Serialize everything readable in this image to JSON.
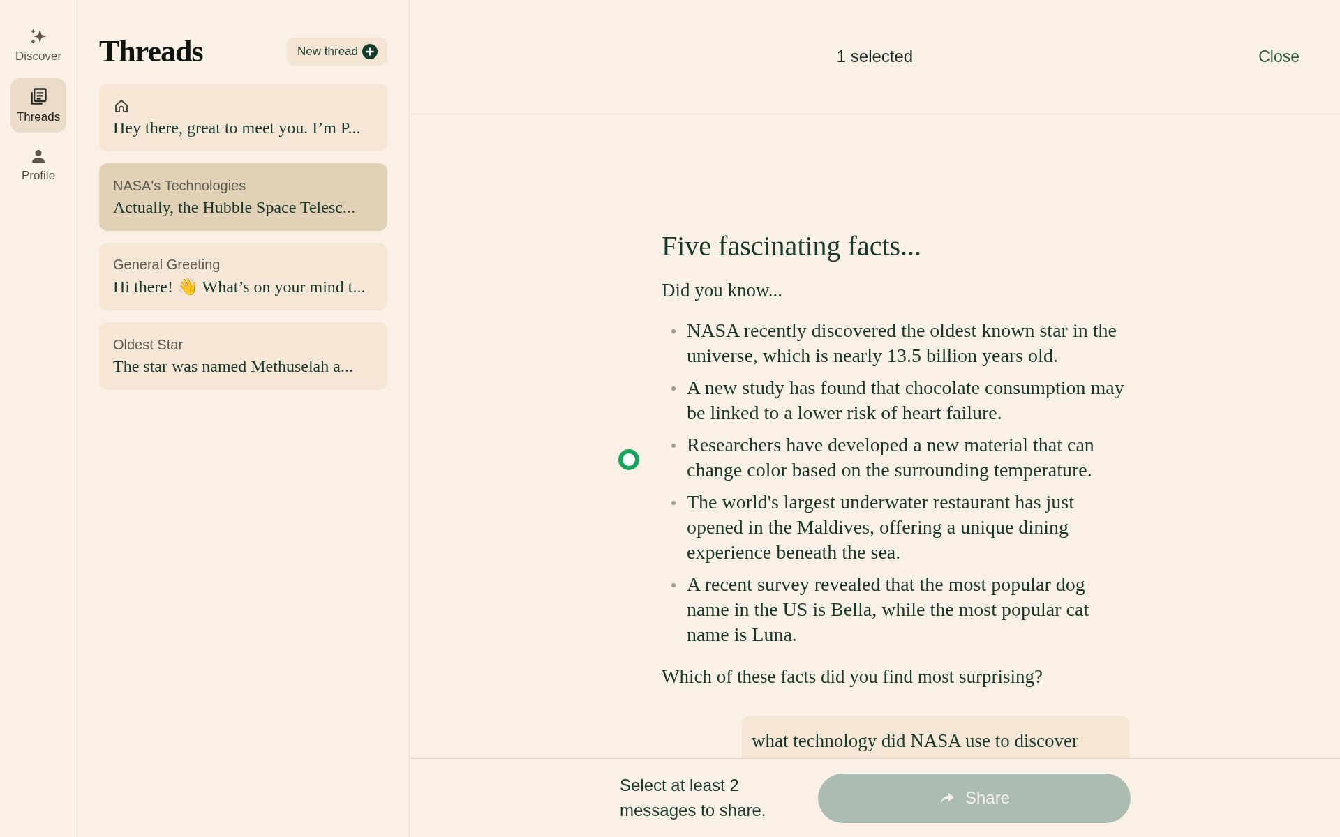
{
  "rail": [
    {
      "label": "Discover",
      "selected": false
    },
    {
      "label": "Threads",
      "selected": true
    },
    {
      "label": "Profile",
      "selected": false
    }
  ],
  "threads_panel": {
    "title": "Threads",
    "new_button": "New thread",
    "items": [
      {
        "kind": "home",
        "preview": "Hey there, great to meet you. I’m P...",
        "selected": false
      },
      {
        "kind": "titled",
        "title": "NASA's Technologies",
        "preview": "Actually, the Hubble Space Telesc...",
        "selected": true
      },
      {
        "kind": "titled",
        "title": "General Greeting",
        "preview": "Hi there! 👋 What’s on your mind t...",
        "selected": false
      },
      {
        "kind": "titled",
        "title": "Oldest Star",
        "preview": "The star was named Methuselah a...",
        "selected": false
      }
    ]
  },
  "header": {
    "status": "1 selected",
    "close": "Close"
  },
  "messages": [
    {
      "kind": "assistant",
      "selected": true,
      "heading": "Five fascinating facts...",
      "intro": "Did you know...",
      "bullets": [
        "NASA recently discovered the oldest known star in the universe, which is nearly 13.5 billion years old.",
        "A new study has found that chocolate consumption may be linked to a lower risk of heart failure.",
        "Researchers have developed a new material that can change color based on the surrounding temperature.",
        "The world's largest underwater restaurant has just opened in the Maldives, offering a unique dining experience beneath the sea.",
        "A recent survey revealed that the most popular dog name in the US is Bella, while the most popular cat name is Luna."
      ],
      "outro": "Which of these facts did you find most surprising?"
    },
    {
      "kind": "user",
      "text": "what technology did NASA use to discover"
    }
  ],
  "footer": {
    "hint": "Select at least 2 messages to share.",
    "share": "Share",
    "share_disabled": true
  }
}
